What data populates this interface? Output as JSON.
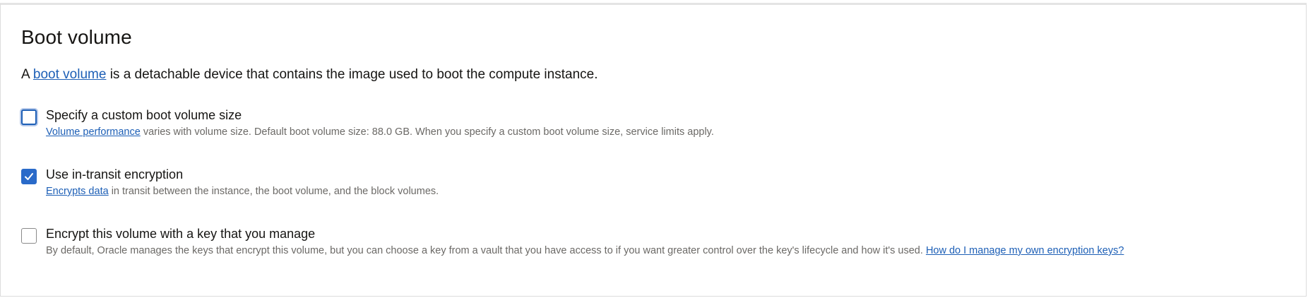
{
  "section": {
    "title": "Boot volume",
    "intro_prefix": "A ",
    "intro_link": "boot volume",
    "intro_suffix": " is a detachable device that contains the image used to boot the compute instance."
  },
  "options": [
    {
      "label": "Specify a custom boot volume size",
      "checked": false,
      "help_link": "Volume performance",
      "help_text": " varies with volume size. Default boot volume size: 88.0 GB. When you specify a custom boot volume size, service limits apply."
    },
    {
      "label": "Use in-transit encryption",
      "checked": true,
      "help_link": "Encrypts data",
      "help_text": " in transit between the instance, the boot volume, and the block volumes."
    },
    {
      "label": "Encrypt this volume with a key that you manage",
      "checked": false,
      "help_text": "By default, Oracle manages the keys that encrypt this volume, but you can choose a key from a vault that you have access to if you want greater control over the key's lifecycle and how it's used. ",
      "help_link": "How do I manage my own encryption keys?"
    }
  ],
  "colors": {
    "link": "#1d5fb6",
    "checkbox_checked": "#2a6ac9",
    "help_text": "#6b6966"
  }
}
